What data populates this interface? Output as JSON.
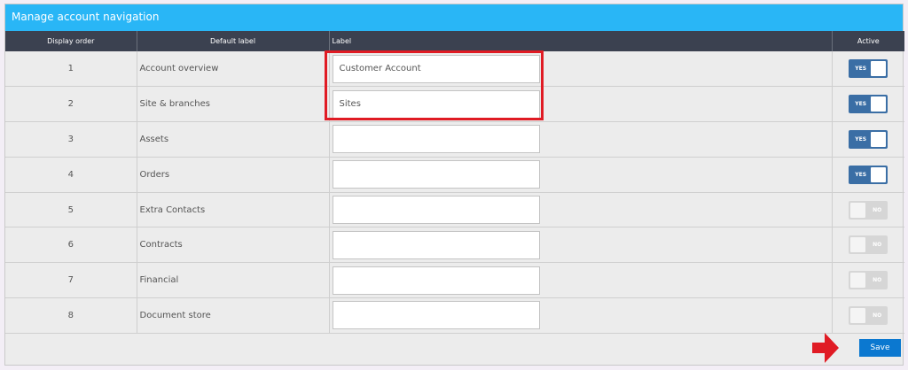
{
  "panel": {
    "title": "Manage account navigation"
  },
  "table": {
    "headers": {
      "display_order": "Display order",
      "default_label": "Default label",
      "label": "Label",
      "active": "Active"
    },
    "rows": [
      {
        "order": "1",
        "default_label": "Account overview",
        "label_value": "Customer Account",
        "active": true,
        "toggle_text": "YES"
      },
      {
        "order": "2",
        "default_label": "Site & branches",
        "label_value": "Sites",
        "active": true,
        "toggle_text": "YES"
      },
      {
        "order": "3",
        "default_label": "Assets",
        "label_value": "",
        "active": true,
        "toggle_text": "YES"
      },
      {
        "order": "4",
        "default_label": "Orders",
        "label_value": "",
        "active": true,
        "toggle_text": "YES"
      },
      {
        "order": "5",
        "default_label": "Extra Contacts",
        "label_value": "",
        "active": false,
        "toggle_text": "NO"
      },
      {
        "order": "6",
        "default_label": "Contracts",
        "label_value": "",
        "active": false,
        "toggle_text": "NO"
      },
      {
        "order": "7",
        "default_label": "Financial",
        "label_value": "",
        "active": false,
        "toggle_text": "NO"
      },
      {
        "order": "8",
        "default_label": "Document store",
        "label_value": "",
        "active": false,
        "toggle_text": "NO"
      }
    ]
  },
  "footer": {
    "save_label": "Save"
  },
  "colors": {
    "header_bar": "#29b6f6",
    "table_head": "#3b4150",
    "toggle_on": "#3a6ea5",
    "toggle_off": "#d6d6d6",
    "save_button": "#0b78d0",
    "annotation_red": "#e01b24"
  },
  "annotations": {
    "highlight": "red-rectangle-around-label-inputs",
    "arrow": "red-arrow-pointing-to-save"
  }
}
